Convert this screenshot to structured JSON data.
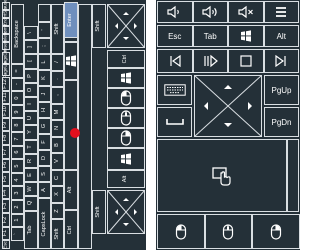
{
  "keyboard": {
    "enter_label": "Enter",
    "backspace_label": "Backspace",
    "shift_top_label": "Shift",
    "shift_bottom_label": "Shift",
    "capslock_label": "CapsLock",
    "tab_label": "Tab",
    "alt_label": "Alt",
    "ctrl_label": "Ctrl",
    "pageup_label": "PageUp",
    "pagedown_label": "PageDn",
    "insert_label": "Insert",
    "delete_label": "Delete",
    "home_label": "Home",
    "end_label": "End",
    "prtsc_label": "PrtSc",
    "pause_label": "Pause",
    "esc_label": "Esc",
    "function_keys": [
      "F1",
      "F2",
      "F3",
      "F4",
      "F5",
      "F6",
      "F7",
      "F8",
      "F9",
      "F10",
      "F11",
      "F12"
    ],
    "row_number_keys": [
      "`",
      "1",
      "2",
      "3",
      "4",
      "5",
      "6",
      "7",
      "8",
      "9",
      "0",
      "-",
      "="
    ],
    "row_q_keys": [
      "Q",
      "W",
      "E",
      "R",
      "T",
      "Y",
      "U",
      "I",
      "O",
      "P",
      "[",
      "]",
      "\\"
    ],
    "row_a_keys": [
      "A",
      "S",
      "D",
      "F",
      "G",
      "H",
      "J",
      "K",
      "L",
      ";",
      "'"
    ],
    "row_z_keys": [
      "Z",
      "X",
      "C",
      "V",
      "B",
      "N",
      "M",
      ",",
      ".",
      "/"
    ]
  },
  "remote": {
    "esc_label": "Esc",
    "tab_label": "Tab",
    "alt_label": "Alt",
    "pageup_label": "PgUp",
    "pagedown_label": "PgDn"
  },
  "icons": {
    "volume_down": "volume-down-icon",
    "volume_up": "volume-up-icon",
    "mute": "mute-icon",
    "menu": "menu-icon",
    "windows": "windows-icon",
    "previous": "previous-track-icon",
    "play_pause": "play-pause-icon",
    "stop": "stop-icon",
    "next": "next-track-icon",
    "keyboard": "keyboard-icon",
    "space": "space-bar-icon",
    "touch": "touch-icon",
    "mouse": "mouse-icon"
  },
  "colors": {
    "panel_bg": "#243038",
    "key_border": "#d9dee2",
    "enter_key_bg": "#6f8fbd",
    "touch_pointer": "#e3101e"
  }
}
